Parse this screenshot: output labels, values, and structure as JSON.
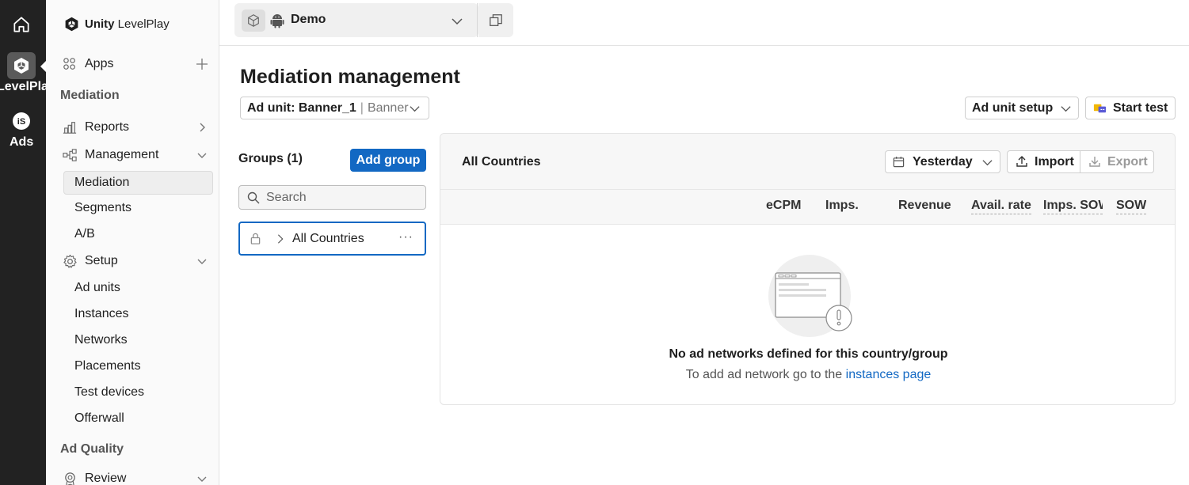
{
  "rail": {
    "items": [
      {
        "label": "LevelPlay",
        "icon": "unity-cube-icon"
      },
      {
        "label": "Ads",
        "icon": "ironsource-icon"
      }
    ]
  },
  "sidebar": {
    "brand_bold": "Unity",
    "brand_light": "LevelPlay",
    "apps_label": "Apps",
    "mediation_section": "Mediation",
    "reports_label": "Reports",
    "management_label": "Management",
    "management_items": [
      "Mediation",
      "Segments",
      "A/B"
    ],
    "setup_label": "Setup",
    "setup_items": [
      "Ad units",
      "Instances",
      "Networks",
      "Placements",
      "Test devices",
      "Offerwall"
    ],
    "ad_quality_section": "Ad Quality",
    "review_label": "Review"
  },
  "topbar": {
    "app_name": "Demo"
  },
  "main": {
    "title": "Mediation management",
    "ad_unit_prefix": "Ad unit: Banner_1",
    "ad_unit_sep": "|",
    "ad_unit_type": "Banner",
    "ad_unit_setup_label": "Ad unit setup",
    "start_test_label": "Start test",
    "groups_title": "Groups (1)",
    "add_group_label": "Add group",
    "search_placeholder": "Search",
    "group_name": "All Countries",
    "group_more": "···"
  },
  "panel": {
    "title": "All Countries",
    "date_label": "Yesterday",
    "import_label": "Import",
    "export_label": "Export",
    "columns": [
      "eCPM",
      "Imps.",
      "Revenue",
      "Avail. rate",
      "Imps. SOW",
      "SOW"
    ],
    "empty_title": "No ad networks defined for this country/group",
    "empty_sub_prefix": "To add ad network go to the",
    "empty_sub_link": "instances page"
  },
  "colors": {
    "primary": "#1268c3",
    "rail_bg": "#222222"
  }
}
